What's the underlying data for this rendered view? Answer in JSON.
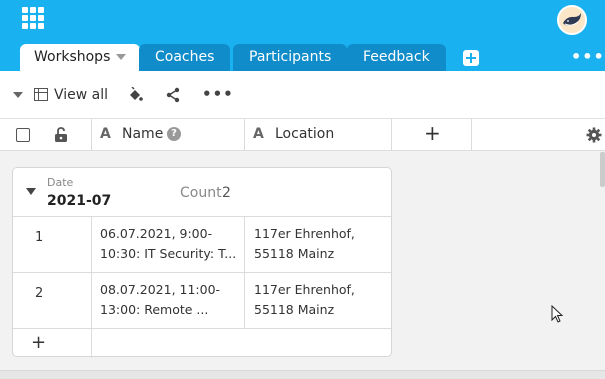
{
  "tabs": [
    {
      "label": "Workshops",
      "active": true
    },
    {
      "label": "Coaches",
      "active": false
    },
    {
      "label": "Participants",
      "active": false
    },
    {
      "label": "Feedback",
      "active": false
    }
  ],
  "toolbar": {
    "view_label": "View all"
  },
  "columns": {
    "name": "Name",
    "location": "Location",
    "type_letter": "A"
  },
  "group": {
    "field": "Date",
    "value": "2021-07",
    "count_label": "Count",
    "count": "2"
  },
  "rows": [
    {
      "index": "1",
      "name_line1": "06.07.2021, 9:00-",
      "name_line2": "10:30: IT Security: T...",
      "loc_line1": "117er Ehrenhof,",
      "loc_line2": "55118 Mainz"
    },
    {
      "index": "2",
      "name_line1": "08.07.2021, 11:00-",
      "name_line2": "13:00: Remote ...",
      "loc_line1": "117er Ehrenhof,",
      "loc_line2": "55118 Mainz"
    }
  ],
  "add_row_label": "+",
  "add_column_label": "+",
  "colors": {
    "brand": "#1ab1f0",
    "tab_inactive": "#0f8cc9"
  }
}
